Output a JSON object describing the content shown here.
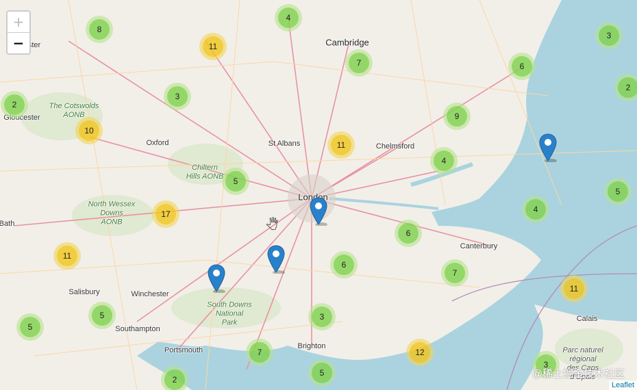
{
  "zoom": {
    "in_label": "+",
    "out_label": "−"
  },
  "attribution": "Leaflet",
  "watermark": "@稀土掘金技术社区",
  "places": [
    {
      "id": "cambridge",
      "name": "Cambridge",
      "big": true
    },
    {
      "id": "gloucester",
      "name": "Gloucester"
    },
    {
      "id": "oxford",
      "name": "Oxford"
    },
    {
      "id": "st-albans",
      "name": "St Albans"
    },
    {
      "id": "chelmsford",
      "name": "Chelmsford"
    },
    {
      "id": "london",
      "name": "London",
      "big": true
    },
    {
      "id": "bath",
      "name": "Bath"
    },
    {
      "id": "canterbury",
      "name": "Canterbury"
    },
    {
      "id": "salisbury",
      "name": "Salisbury"
    },
    {
      "id": "winchester",
      "name": "Winchester"
    },
    {
      "id": "southampton",
      "name": "Southampton"
    },
    {
      "id": "portsmouth",
      "name": "Portsmouth"
    },
    {
      "id": "brighton",
      "name": "Brighton"
    },
    {
      "id": "calais",
      "name": "Calais"
    },
    {
      "id": "worcester-partial",
      "name": "ster"
    }
  ],
  "areas": [
    {
      "id": "cotswolds",
      "lines": [
        "The Cotswolds",
        "AONB"
      ]
    },
    {
      "id": "chiltern",
      "lines": [
        "Chiltern",
        "Hills AONB"
      ]
    },
    {
      "id": "north-wessex",
      "lines": [
        "North Wessex",
        "Downs",
        "AONB"
      ]
    },
    {
      "id": "south-downs",
      "lines": [
        "South Downs",
        "National",
        "Park"
      ]
    },
    {
      "id": "caps-opale",
      "lines": [
        "Parc naturel",
        "régional",
        "des Caps",
        "d'Opale"
      ]
    }
  ],
  "clusters": [
    {
      "count": 8,
      "level": "small"
    },
    {
      "count": 4,
      "level": "small"
    },
    {
      "count": 11,
      "level": "medium"
    },
    {
      "count": 7,
      "level": "small"
    },
    {
      "count": 6,
      "level": "small"
    },
    {
      "count": 3,
      "level": "small"
    },
    {
      "count": 2,
      "level": "small"
    },
    {
      "count": 2,
      "level": "small"
    },
    {
      "count": 3,
      "level": "small"
    },
    {
      "count": 9,
      "level": "small"
    },
    {
      "count": 10,
      "level": "medium"
    },
    {
      "count": 11,
      "level": "medium"
    },
    {
      "count": 4,
      "level": "small"
    },
    {
      "count": 5,
      "level": "small"
    },
    {
      "count": 5,
      "level": "small"
    },
    {
      "count": 17,
      "level": "medium"
    },
    {
      "count": 4,
      "level": "small"
    },
    {
      "count": 6,
      "level": "small"
    },
    {
      "count": 11,
      "level": "medium"
    },
    {
      "count": 6,
      "level": "small"
    },
    {
      "count": 7,
      "level": "small"
    },
    {
      "count": 11,
      "level": "medium"
    },
    {
      "count": 5,
      "level": "small"
    },
    {
      "count": 5,
      "level": "small"
    },
    {
      "count": 3,
      "level": "small"
    },
    {
      "count": 7,
      "level": "small"
    },
    {
      "count": 12,
      "level": "medium"
    },
    {
      "count": 2,
      "level": "small"
    },
    {
      "count": 5,
      "level": "small"
    },
    {
      "count": 3,
      "level": "small"
    }
  ],
  "markers": [
    {
      "id": "marker-sea"
    },
    {
      "id": "marker-london"
    },
    {
      "id": "marker-surrey"
    },
    {
      "id": "marker-hampshire"
    }
  ]
}
